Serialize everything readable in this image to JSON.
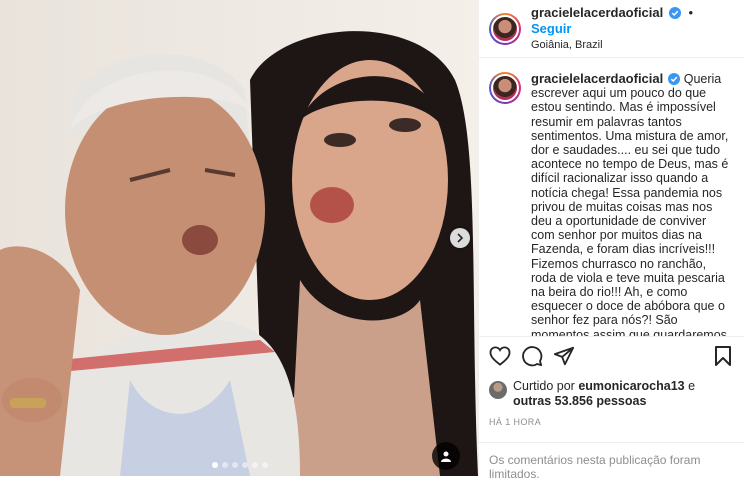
{
  "post": {
    "username": "gracielelacerdaoficial",
    "separator": "•",
    "follow_label": "Seguir",
    "location": "Goiânia, Brazil",
    "caption": "Queria escrever aqui um pouco do que estou sentindo. Mas é impossível resumir em palavras tantos sentimentos. Uma mistura de amor, dor e saudades.... eu sei que tudo acontece no tempo de Deus, mas é difícil racionalizar isso quando a notícia chega! Essa pandemia nos privou de muitas coisas mas nos deu a oportunidade de conviver com senhor por muitos dias na Fazenda, e foram dias incríveis!!! Fizemos churrasco no ranchão, roda de viola e teve muita pescaria na beira do rio!!! Ah, e como esquecer o doce de abóbora que o senhor fez para nós?! São momentos assim que guardaremos em nossos corações!!! Obrigada, por ter sido esse homem tão incrível, sua",
    "likes_prefix": "Curtido por ",
    "liked_by": "eumonicarocha13",
    "likes_middle": " e ",
    "likes_others": "outras 53.856 pessoas",
    "time_ago": "HÁ 1 HORA",
    "comments_limited": "Os comentários nesta publicação foram limitados.",
    "carousel": {
      "count": 6,
      "active_index": 0
    }
  },
  "icons": {
    "verified": "verified-badge-icon",
    "like": "heart-icon",
    "comment": "comment-icon",
    "share": "share-icon",
    "save": "bookmark-icon",
    "next": "chevron-right-icon",
    "tag": "user-tag-icon"
  },
  "colors": {
    "link": "#0095f6",
    "verified": "#3897f0",
    "muted": "#8e8e8e",
    "text": "#262626"
  }
}
